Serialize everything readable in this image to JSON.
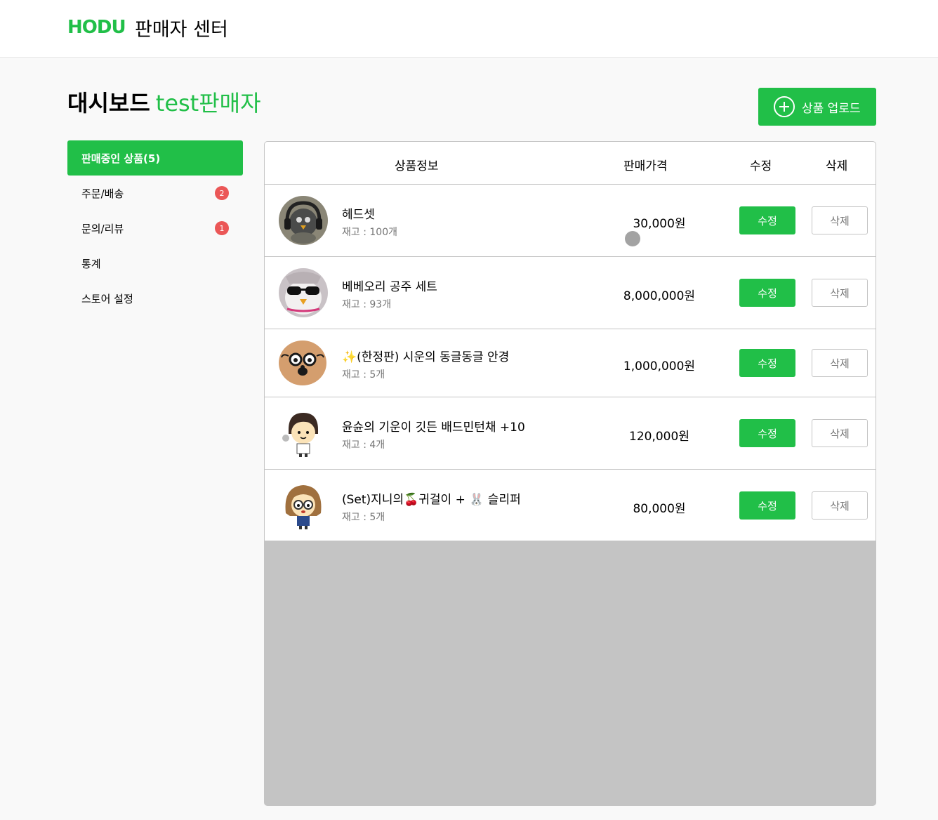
{
  "header": {
    "logo": "HODU",
    "title": "판매자 센터"
  },
  "dashboard": {
    "title": "대시보드",
    "seller": "test판매자"
  },
  "upload_button": {
    "label": "상품 업로드"
  },
  "sidebar": {
    "items": [
      {
        "label": "판매중인 상품(5)",
        "badge": ""
      },
      {
        "label": "주문/배송",
        "badge": "2"
      },
      {
        "label": "문의/리뷰",
        "badge": "1"
      },
      {
        "label": "통계",
        "badge": ""
      },
      {
        "label": "스토어 설정",
        "badge": ""
      }
    ]
  },
  "table": {
    "headers": {
      "info": "상품정보",
      "price": "판매가격",
      "edit": "수정",
      "delete": "삭제"
    },
    "rows": [
      {
        "name": "헤드셋",
        "stock": "재고 : 100개",
        "price": "30,000원",
        "edit": "수정",
        "delete": "삭제"
      },
      {
        "name": "베베오리 공주 세트",
        "stock": "재고 : 93개",
        "price": "8,000,000원",
        "edit": "수정",
        "delete": "삭제"
      },
      {
        "name": "✨(한정판) 시운의 동글동글 안경",
        "stock": "재고 : 5개",
        "price": "1,000,000원",
        "edit": "수정",
        "delete": "삭제"
      },
      {
        "name": "윤슌의 기운이 깃든 배드민턴채 +10",
        "stock": "재고 : 4개",
        "price": "120,000원",
        "edit": "수정",
        "delete": "삭제"
      },
      {
        "name": "(Set)지니의🍒귀걸이 + 🐰 슬리퍼",
        "stock": "재고 : 5개",
        "price": "80,000원",
        "edit": "수정",
        "delete": "삭제"
      }
    ]
  },
  "colors": {
    "accent": "#21bf48",
    "badge": "#eb5757",
    "muted": "#767676",
    "border": "#c4c4c4"
  }
}
